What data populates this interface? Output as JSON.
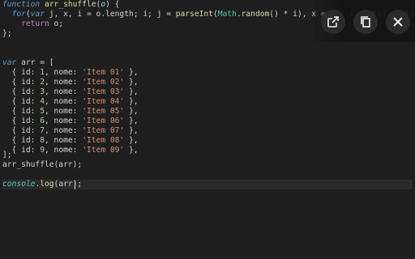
{
  "code": {
    "l1": {
      "kw_function": "function",
      "fn_name": "arr_shuffle",
      "open_paren": "(",
      "param": "o",
      "close": ") {"
    },
    "l2": {
      "indent": "  ",
      "for": "for",
      "p1": "(",
      "var": "var",
      "vars": " j, x, i = ",
      "o": "o",
      "length": ".length",
      "semi1": "; i; j = ",
      "parseInt": "parseInt",
      "p2": "(",
      "Math": "Math",
      "random": ".random",
      "rest": "() * i), x = o[--i], o[i] = o[j], o[j] = x);"
    },
    "l3": {
      "indent": "    ",
      "return": "return",
      "rest": " o;"
    },
    "l4": {
      "text": "};"
    },
    "l7": {
      "var": "var",
      "rest": " arr = ["
    },
    "items": [
      {
        "id": "1",
        "nome": "'Item 01'"
      },
      {
        "id": "2",
        "nome": "'Item 02'"
      },
      {
        "id": "3",
        "nome": "'Item 03'"
      },
      {
        "id": "4",
        "nome": "'Item 04'"
      },
      {
        "id": "5",
        "nome": "'Item 05'"
      },
      {
        "id": "6",
        "nome": "'Item 06'"
      },
      {
        "id": "7",
        "nome": "'Item 07'"
      },
      {
        "id": "8",
        "nome": "'Item 08'"
      },
      {
        "id": "9",
        "nome": "'Item 09'"
      }
    ],
    "item_prefix": "  { id: ",
    "item_mid": ", nome: ",
    "item_suffix": " },",
    "close_arr": "];",
    "call": "arr_shuffle(arr);",
    "console": {
      "obj": "console",
      "method": ".log",
      "args": "(arr);"
    }
  },
  "toolbar": {
    "open_icon": "open-in-new-icon",
    "copy_icon": "copy-icon",
    "close_icon": "close-icon"
  }
}
